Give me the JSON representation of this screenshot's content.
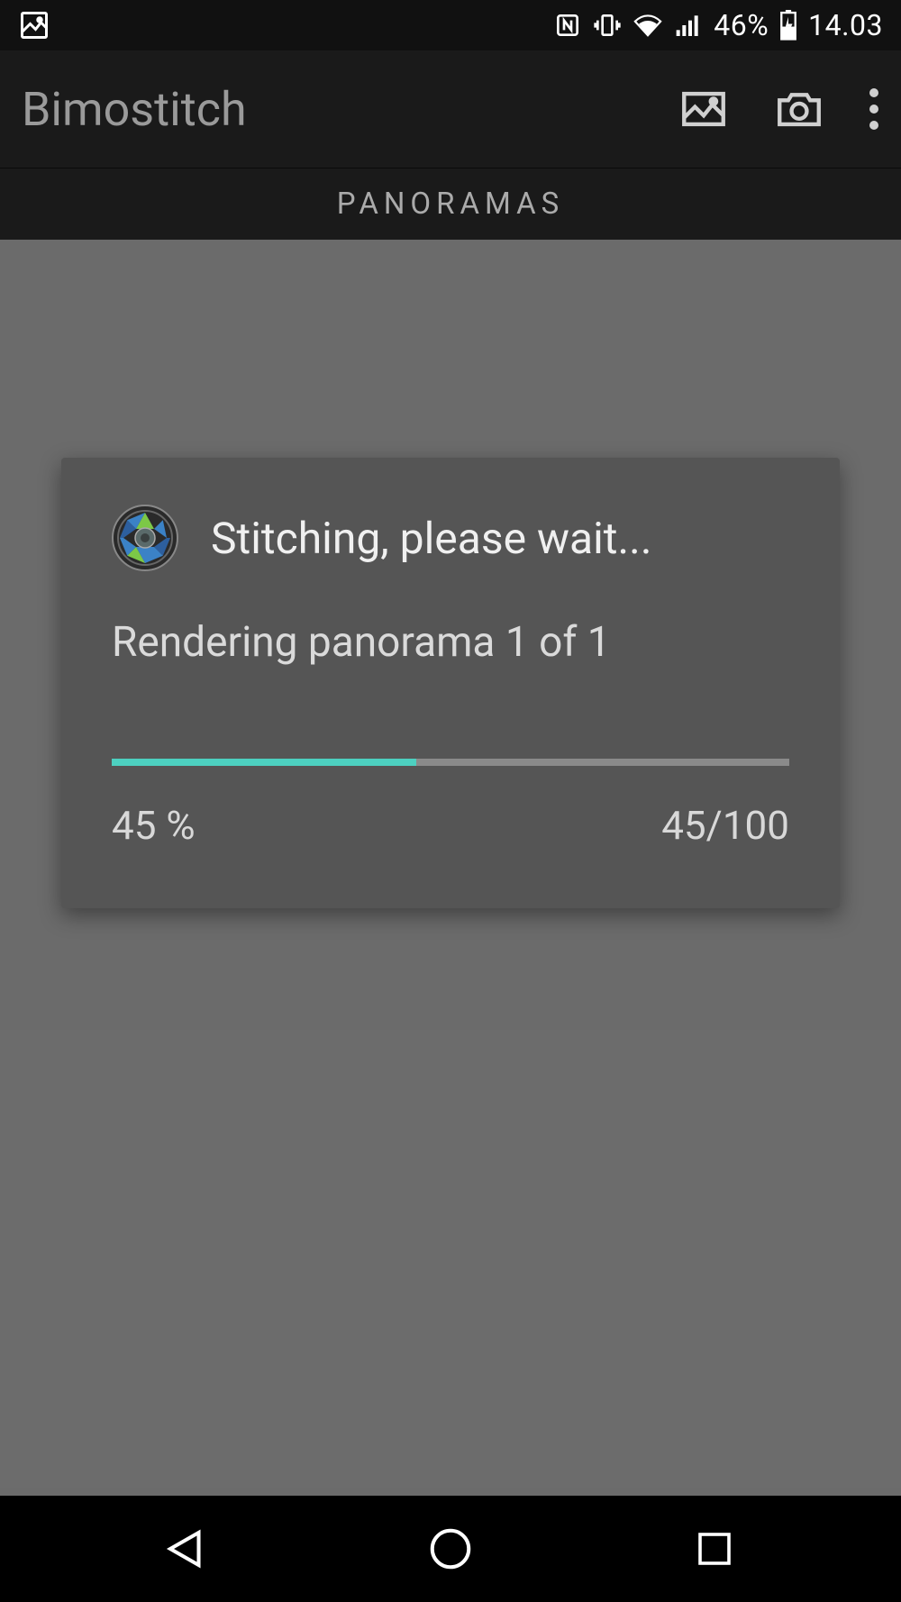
{
  "status_bar": {
    "battery_percent": "46%",
    "time": "14.03"
  },
  "app_bar": {
    "title": "Bimostitch"
  },
  "tab": {
    "label": "PANORAMAS"
  },
  "dialog": {
    "title": "Stitching, please wait...",
    "status": "Rendering panorama 1 of 1",
    "progress_percent_label": "45 %",
    "progress_count_label": "45/100",
    "progress_value": 45
  },
  "colors": {
    "accent": "#4dd0c0",
    "dialog_bg": "#555555",
    "app_bg_dark": "#1a1a1a"
  }
}
